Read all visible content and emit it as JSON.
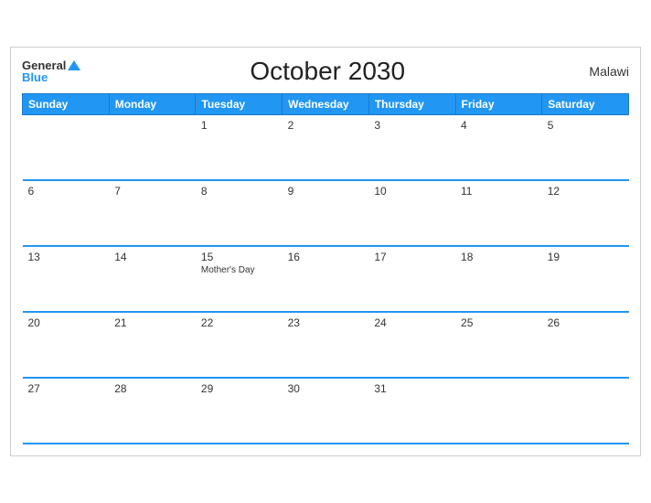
{
  "header": {
    "logo_general": "General",
    "logo_blue": "Blue",
    "title": "October 2030",
    "country": "Malawi"
  },
  "weekdays": [
    "Sunday",
    "Monday",
    "Tuesday",
    "Wednesday",
    "Thursday",
    "Friday",
    "Saturday"
  ],
  "weeks": [
    [
      {
        "day": "",
        "event": ""
      },
      {
        "day": "",
        "event": ""
      },
      {
        "day": "1",
        "event": ""
      },
      {
        "day": "2",
        "event": ""
      },
      {
        "day": "3",
        "event": ""
      },
      {
        "day": "4",
        "event": ""
      },
      {
        "day": "5",
        "event": ""
      }
    ],
    [
      {
        "day": "6",
        "event": ""
      },
      {
        "day": "7",
        "event": ""
      },
      {
        "day": "8",
        "event": ""
      },
      {
        "day": "9",
        "event": ""
      },
      {
        "day": "10",
        "event": ""
      },
      {
        "day": "11",
        "event": ""
      },
      {
        "day": "12",
        "event": ""
      }
    ],
    [
      {
        "day": "13",
        "event": ""
      },
      {
        "day": "14",
        "event": ""
      },
      {
        "day": "15",
        "event": "Mother's Day"
      },
      {
        "day": "16",
        "event": ""
      },
      {
        "day": "17",
        "event": ""
      },
      {
        "day": "18",
        "event": ""
      },
      {
        "day": "19",
        "event": ""
      }
    ],
    [
      {
        "day": "20",
        "event": ""
      },
      {
        "day": "21",
        "event": ""
      },
      {
        "day": "22",
        "event": ""
      },
      {
        "day": "23",
        "event": ""
      },
      {
        "day": "24",
        "event": ""
      },
      {
        "day": "25",
        "event": ""
      },
      {
        "day": "26",
        "event": ""
      }
    ],
    [
      {
        "day": "27",
        "event": ""
      },
      {
        "day": "28",
        "event": ""
      },
      {
        "day": "29",
        "event": ""
      },
      {
        "day": "30",
        "event": ""
      },
      {
        "day": "31",
        "event": ""
      },
      {
        "day": "",
        "event": ""
      },
      {
        "day": "",
        "event": ""
      }
    ]
  ]
}
